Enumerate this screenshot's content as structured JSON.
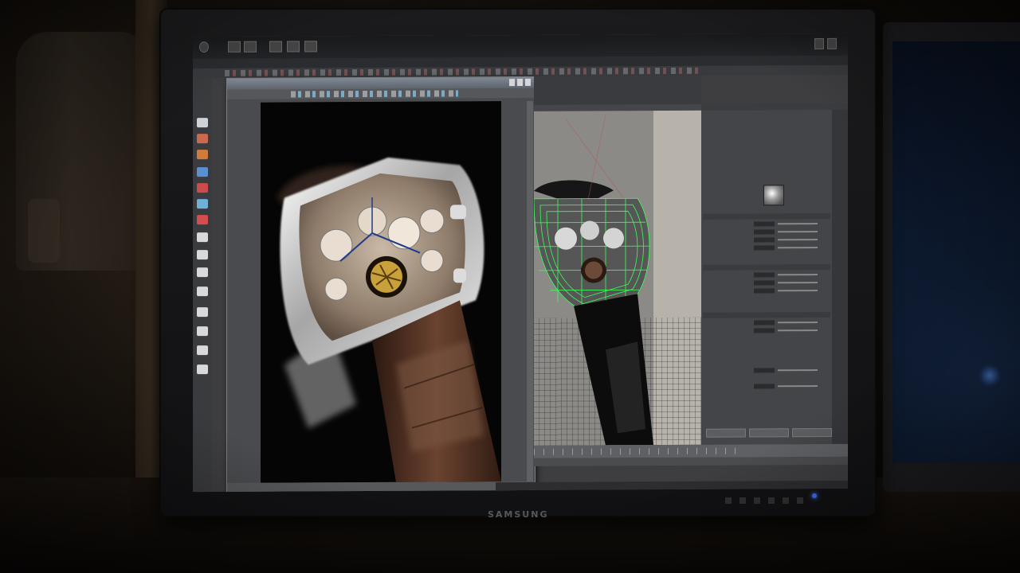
{
  "monitor": {
    "brand": "SAMSUNG"
  },
  "colors": {
    "wireframe": "#39ff5a",
    "gold": "#c9a13a",
    "leather": "#4a2b1c"
  },
  "icons": [
    "select-tool-icon",
    "move-tool-icon",
    "rotate-tool-icon",
    "scale-tool-icon",
    "close-icon",
    "minimize-icon",
    "maximize-icon"
  ]
}
